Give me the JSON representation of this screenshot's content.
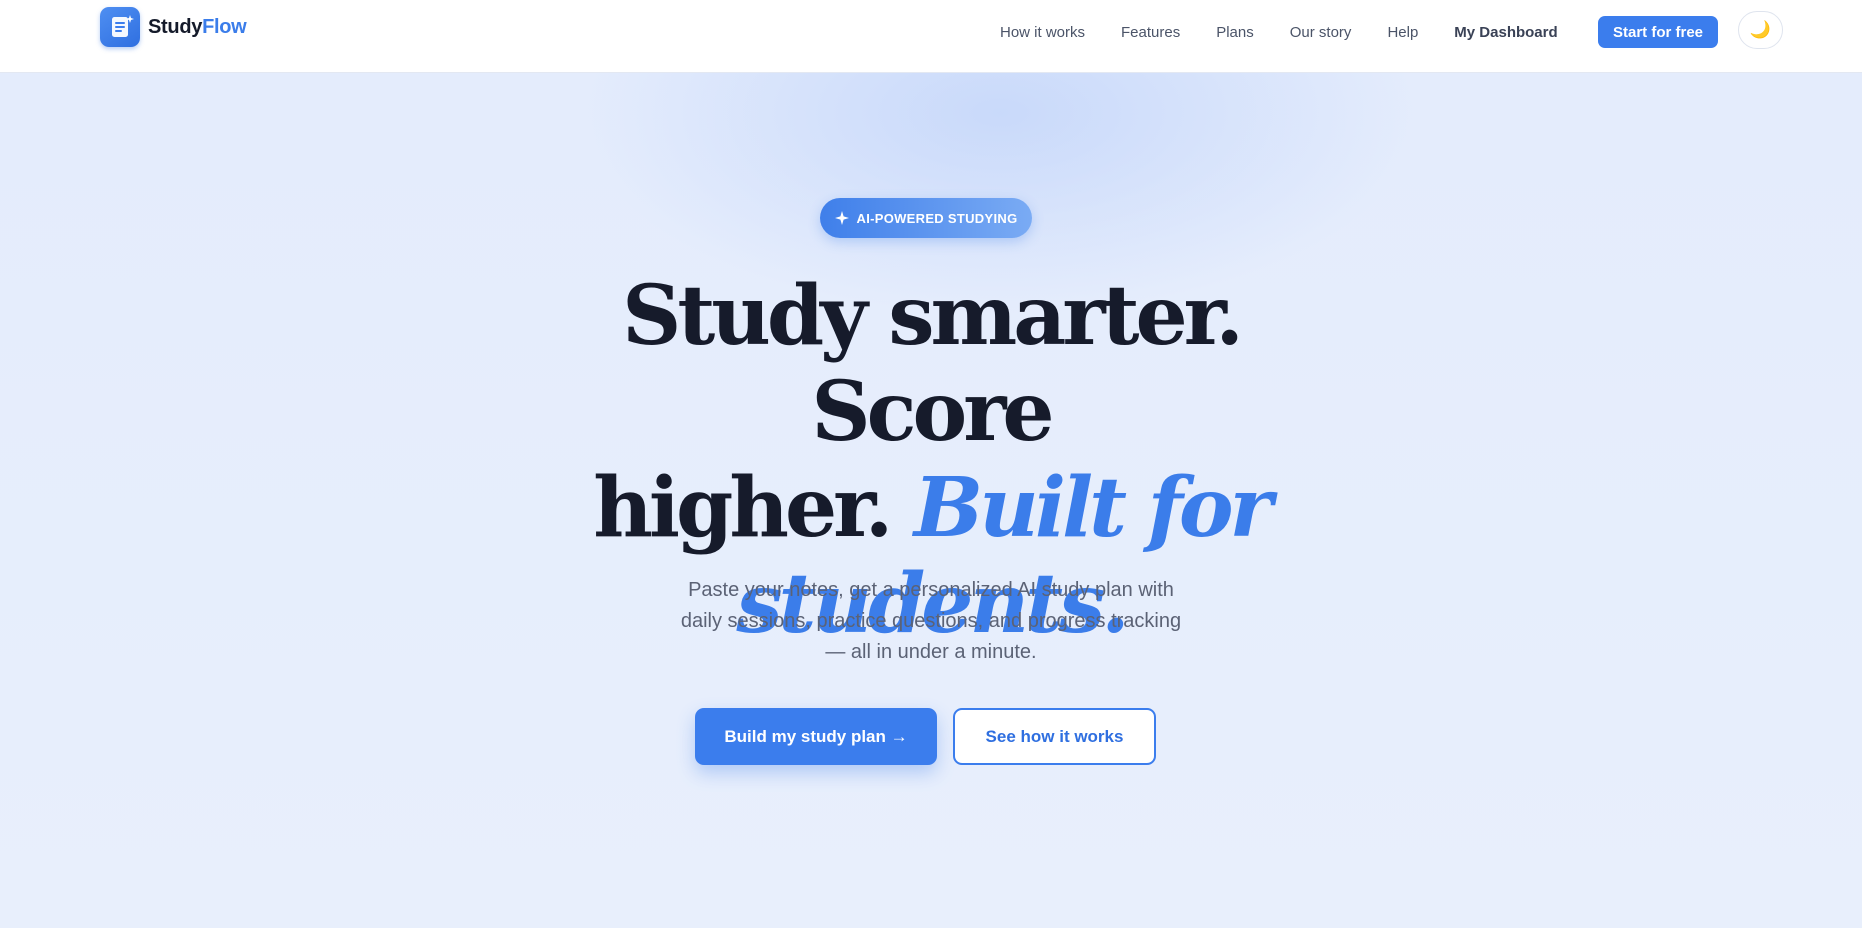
{
  "brand": {
    "name_part1": "Study",
    "name_part2": "Flow",
    "logo_icon": "document-sparkle-icon"
  },
  "nav": {
    "links": [
      "How it works",
      "Features",
      "Plans",
      "Our story",
      "Help",
      "My Dashboard"
    ],
    "cta_label": "Start for free",
    "theme_toggle_icon": "moon-icon",
    "theme_toggle_glyph": "🌙"
  },
  "hero": {
    "badge": "AI-POWERED STUDYING",
    "badge_icon": "sparkle-icon",
    "headline_line1": "Study smarter. Score",
    "headline_line2_plain": "higher.",
    "headline_line2_accent": "Built for",
    "headline_line3_accent": "students.",
    "subtitle": "Paste your notes, get a personalized AI study plan with daily sessions, practice questions, and progress tracking — all in under a minute.",
    "primary_button": "Build my study plan →",
    "secondary_button": "See how it works"
  },
  "colors": {
    "accent": "#3b7ded",
    "heading": "#161b2b",
    "background": "#e6eefc"
  }
}
